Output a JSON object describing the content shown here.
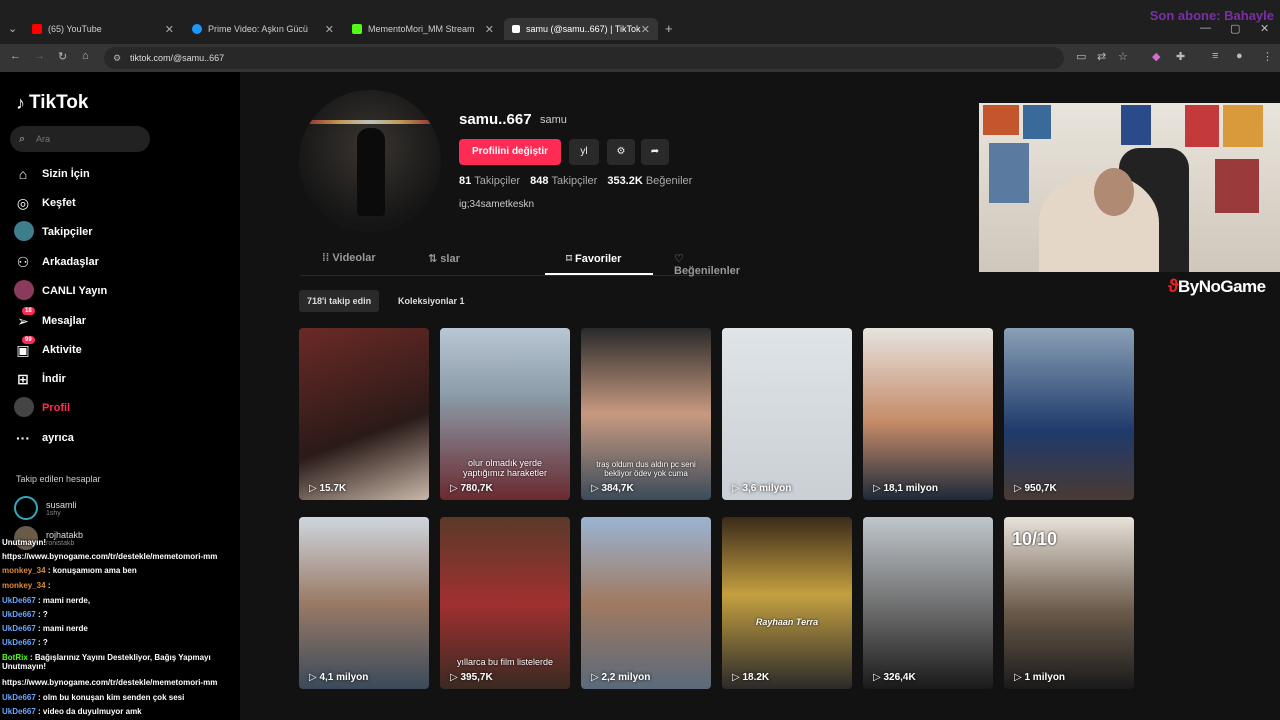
{
  "browser": {
    "tabs": [
      {
        "label": "(65) YouTube",
        "color": "#ff0000"
      },
      {
        "label": "Prime Video: Aşkın Gücü",
        "color": "#1a98ff"
      },
      {
        "label": "MementoMori_MM Stream",
        "color": "#53fc18"
      },
      {
        "label": "samu (@samu..667) | TikTok",
        "color": "#ffffff"
      }
    ],
    "url": "tiktok.com/@samu..667"
  },
  "overlay_title": "Son abone: Bahayle",
  "sidebar": {
    "logo": "TikTok",
    "search_placeholder": "Ara",
    "items": [
      {
        "label": "Sizin İçin",
        "icon": "home-icon"
      },
      {
        "label": "Keşfet",
        "icon": "compass-icon"
      },
      {
        "label": "Takipçiler",
        "icon": "avatar-icon"
      },
      {
        "label": "Arkadaşlar",
        "icon": "friends-icon"
      },
      {
        "label": "CANLI Yayın",
        "icon": "avatar-icon"
      },
      {
        "label": "Mesajlar",
        "icon": "send-icon",
        "badge": "18"
      },
      {
        "label": "Aktivite",
        "icon": "activity-icon",
        "badge": "99"
      },
      {
        "label": "İndir",
        "icon": "download-icon"
      },
      {
        "label": "Profil",
        "icon": "avatar-icon"
      },
      {
        "label": "ayrıca",
        "icon": "more-icon"
      }
    ],
    "following_title": "Takip edilen hesaplar",
    "following": [
      {
        "name": "susamli",
        "sub": "1shy"
      },
      {
        "name": "rojhatakb",
        "sub": "ronistakb"
      }
    ]
  },
  "profile": {
    "username": "samu..667",
    "nickname": "samu",
    "edit_label": "Profilini değiştir",
    "yl_label": "yl",
    "following_count": "81",
    "following_label": "Takipçiler",
    "followers_count": "848",
    "followers_label": "Takipçiler",
    "likes_count": "353.2K",
    "likes_label": "Beğeniler",
    "bio": "ig;34sametkeskn"
  },
  "tabs": [
    {
      "label": "Videolar",
      "icon": "grid-icon"
    },
    {
      "label": "slar",
      "icon": "repost-icon"
    },
    {
      "label": "Favoriler",
      "icon": "bookmark-icon"
    },
    {
      "label": "Beğenilenler",
      "icon": "heart-icon"
    }
  ],
  "chips": [
    "718'i takip edin",
    "Koleksiyonlar 1"
  ],
  "videos": [
    {
      "views": "15.7K",
      "caption": "",
      "bg": "linear-gradient(160deg,#6b2a26,#2a1a18 60%,#c9b8a8)"
    },
    {
      "views": "780,7K",
      "caption": "olur olmadık yerde yaptığımız haraketler",
      "bg": "linear-gradient(180deg,#b8c7d3,#8a9aa6 40%,#6a2a30)"
    },
    {
      "views": "384,7K",
      "caption": "traş oldum dus aldın pc seni bekliyor ödev yok cuma",
      "bg": "linear-gradient(180deg,#2a2a2a,#c89a80 50%,#3b4b5a)"
    },
    {
      "views": "3,6 milyon",
      "caption": "",
      "bg": "linear-gradient(180deg,#dfe4e8,#c9cfd4)"
    },
    {
      "views": "18,1 milyon",
      "caption": "",
      "bg": "linear-gradient(180deg,#e6e3df,#c58a66 55%,#1d2a3a)"
    },
    {
      "views": "950,7K",
      "caption": "",
      "bg": "linear-gradient(180deg,#8aa0b5,#1f3a6b 60%,#4a3a33)"
    },
    {
      "views": "4,1 milyon",
      "caption": "",
      "bg": "linear-gradient(180deg,#cfd6de,#9a7a66 50%,#3a4a5a)"
    },
    {
      "views": "395,7K",
      "caption": "yıllarca bu film listelerde",
      "bg": "linear-gradient(180deg,#5a3a2a,#a03030 50%,#3a2a22)"
    },
    {
      "views": "2,2 milyon",
      "caption": "",
      "bg": "linear-gradient(180deg,#9ab4d2,#a07a62 50%,#5a6a7a)"
    },
    {
      "views": "18.2K",
      "caption": "Rayhaan Terra",
      "bg": "linear-gradient(180deg,#3a2a1a,#c4a040 45%,#2a2a2a)"
    },
    {
      "views": "326,4K",
      "caption": "",
      "bg": "linear-gradient(180deg,#bfc6cc,#6a6a6a 55%,#1a1a1a)"
    },
    {
      "views": "1 milyon",
      "caption": "10/10",
      "bg": "linear-gradient(180deg,#e8e2da,#6a5a4a 55%,#1a1a1a)"
    }
  ],
  "brand": "ByNoGame",
  "chat": [
    {
      "user": "",
      "text": "Unutmayın!"
    },
    {
      "user": "",
      "text": "https://www.bynogame.com/tr/destekle/memetomori-mm"
    },
    {
      "user": "monkey_34",
      "text": ": konuşamıom ama ben"
    },
    {
      "user": "monkey_34",
      "text": ":"
    },
    {
      "user": "UkDe667",
      "text": ": mami nerde,"
    },
    {
      "user": "UkDe667",
      "text": ": ?"
    },
    {
      "user": "UkDe667",
      "text": ": mami nerde"
    },
    {
      "user": "UkDe667",
      "text": ": ?"
    },
    {
      "user": "BotRix",
      "text": ": Bağışlarınız Yayını Destekliyor, Bağış Yapmayı Unutmayın!"
    },
    {
      "user": "",
      "text": "https://www.bynogame.com/tr/destekle/memetomori-mm"
    },
    {
      "user": "UkDe667",
      "text": ": olm bu konuşan kim senden çok sesi"
    },
    {
      "user": "UkDe667",
      "text": ": video da duyulmuyor amk"
    }
  ]
}
